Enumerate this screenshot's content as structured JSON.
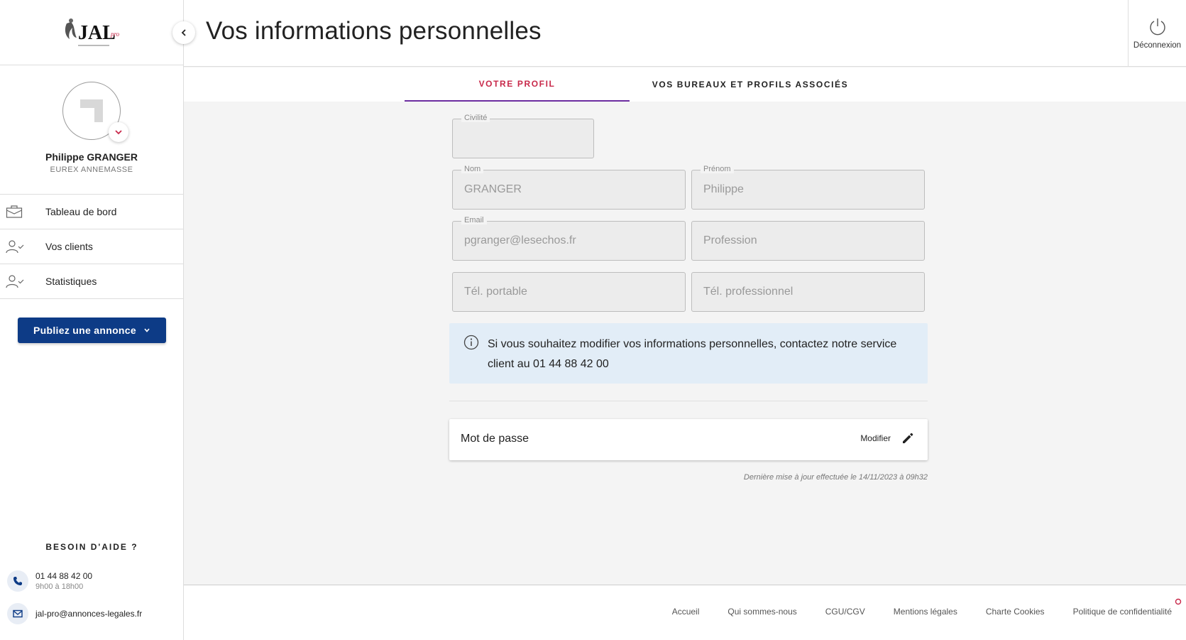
{
  "header": {
    "title": "Vos informations personnelles",
    "logout_label": "Déconnexion"
  },
  "sidebar": {
    "logo_text": "JAL",
    "user": {
      "name": "Philippe GRANGER",
      "office": "EUREX ANNEMASSE"
    },
    "nav": [
      {
        "label": "Tableau de bord",
        "icon": "briefcase-icon"
      },
      {
        "label": "Vos clients",
        "icon": "user-check-icon"
      },
      {
        "label": "Statistiques",
        "icon": "user-check-icon"
      }
    ],
    "publish_label": "Publiez une annonce",
    "help": {
      "title": "BESOIN D'AIDE ?",
      "phone": "01 44 88 42 00",
      "hours": "9h00 à 18h00",
      "email": "jal-pro@annonces-legales.fr"
    }
  },
  "tabs": [
    {
      "label": "VOTRE PROFIL",
      "active": true
    },
    {
      "label": "VOS BUREAUX ET PROFILS ASSOCIÉS",
      "active": false
    }
  ],
  "form": {
    "civilite": {
      "label": "Civilité",
      "value": ""
    },
    "nom": {
      "label": "Nom",
      "value": "GRANGER"
    },
    "prenom": {
      "label": "Prénom",
      "value": "Philippe"
    },
    "email": {
      "label": "Email",
      "value": "pgranger@lesechos.fr"
    },
    "profession": {
      "placeholder": "Profession"
    },
    "tel_portable": {
      "placeholder": "Tél. portable"
    },
    "tel_pro": {
      "placeholder": "Tél. professionnel"
    }
  },
  "info_message": "Si vous souhaitez modifier vos informations personnelles, contactez notre service client au 01 44 88 42 00",
  "password": {
    "label": "Mot de passe",
    "modify_label": "Modifier"
  },
  "last_update": "Dernière mise à jour effectuée le 14/11/2023 à 09h32",
  "footer": {
    "links": [
      "Accueil",
      "Qui sommes-nous",
      "CGU/CGV",
      "Mentions légales",
      "Charte Cookies",
      "Politique de confidentialité"
    ]
  },
  "colors": {
    "primary": "#0d3b86",
    "accent_red": "#c8294a",
    "tab_underline": "#6c2da0",
    "info_bg": "#e2edf7"
  }
}
